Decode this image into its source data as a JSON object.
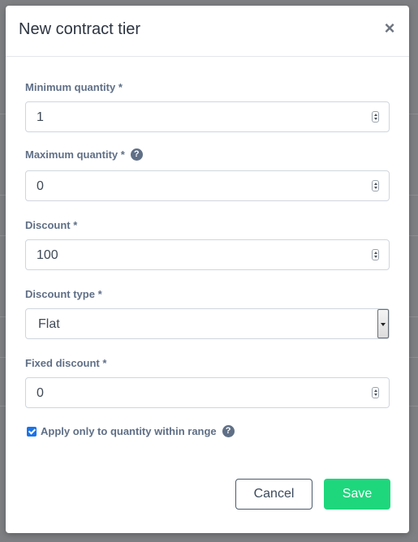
{
  "modal": {
    "title": "New contract tier",
    "close_icon": "close-icon"
  },
  "fields": {
    "min_quantity": {
      "label": "Minimum quantity *",
      "value": "1"
    },
    "max_quantity": {
      "label": "Maximum quantity *",
      "value": "0",
      "help_icon": "question-circle-icon"
    },
    "discount": {
      "label": "Discount *",
      "value": "100"
    },
    "discount_type": {
      "label": "Discount type *",
      "value": "Flat"
    },
    "fixed_discount": {
      "label": "Fixed discount *",
      "value": "0"
    }
  },
  "checkbox": {
    "label": "Apply only to quantity within range",
    "checked": true,
    "help_icon": "question-circle-icon"
  },
  "buttons": {
    "cancel_label": "Cancel",
    "save_label": "Save"
  },
  "colors": {
    "save_button": "#1ed77d",
    "label_text": "#5f6f86",
    "checkbox": "#1a73e8"
  }
}
